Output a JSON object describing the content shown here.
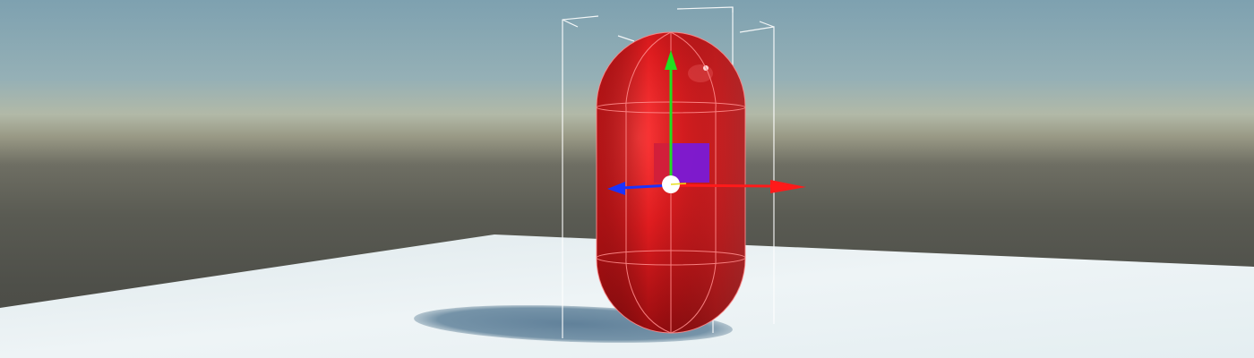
{
  "scene": {
    "selected_object": "capsule",
    "colors": {
      "sky_top": "#7fa3b2",
      "horizon": "#a9b1a4",
      "ground_far": "#55564e",
      "floor": "#e8f0f2",
      "shadow": "#6e8da0",
      "capsule": "#d0161a",
      "capsule_wire": "#ff8a8a",
      "axis_x": "#ff1a1a",
      "axis_y": "#20e020",
      "axis_z": "#1a33ff",
      "plane_handle": "#7a1ad6",
      "center_handle": "#ffffff",
      "bounds": "#ffffff"
    },
    "gizmo": {
      "axes": [
        "x-axis",
        "y-axis",
        "z-axis"
      ],
      "handles": [
        "xy-plane-handle",
        "center-handle"
      ]
    }
  }
}
